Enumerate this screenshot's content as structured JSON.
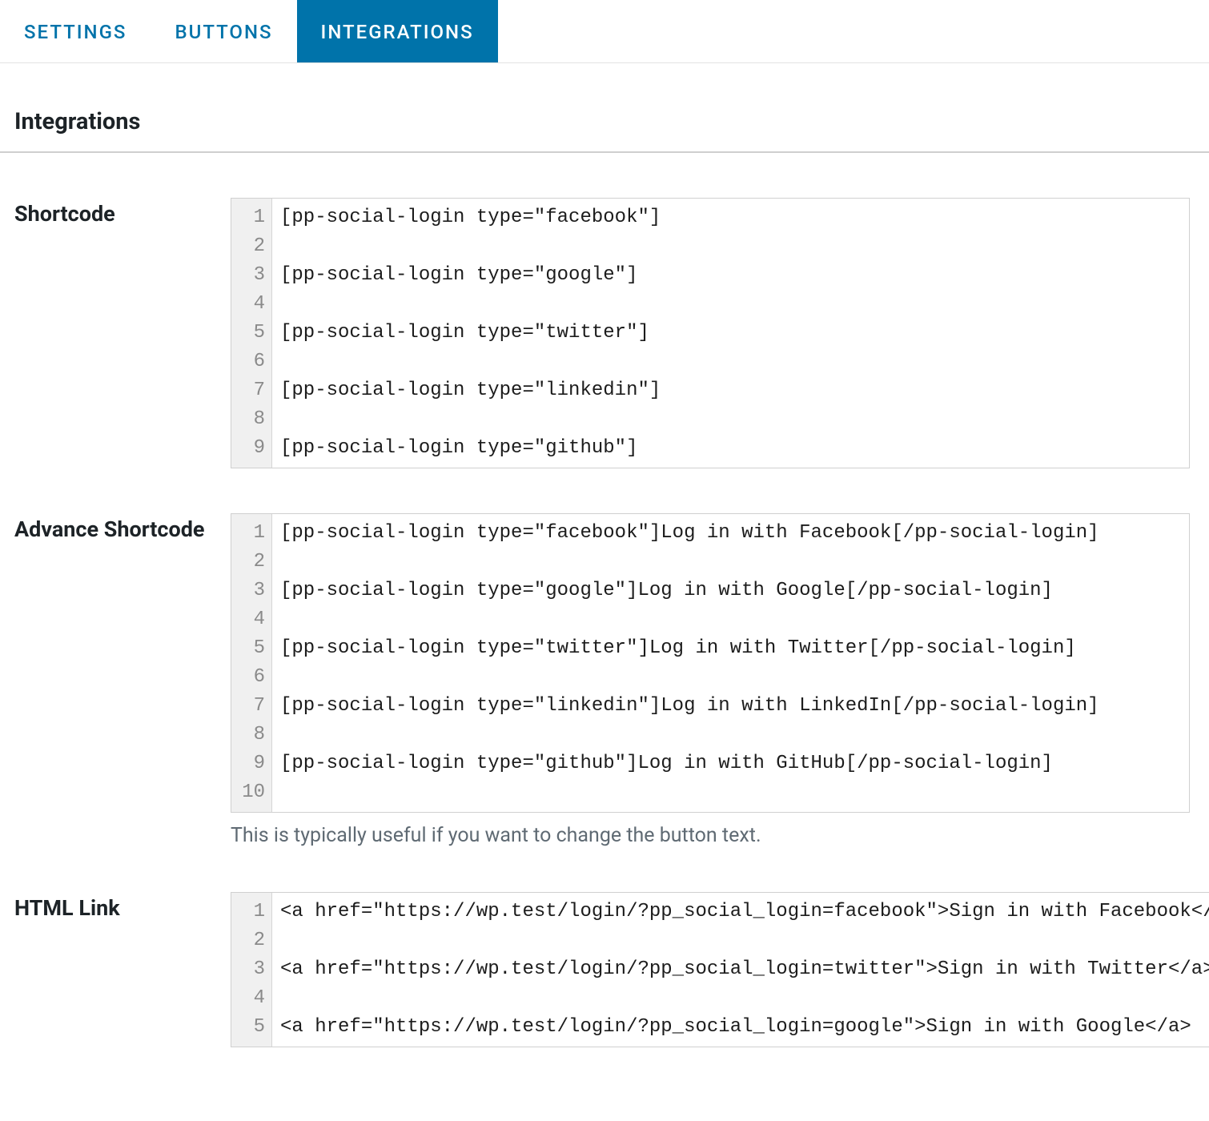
{
  "tabs": [
    {
      "label": "SETTINGS",
      "active": false
    },
    {
      "label": "BUTTONS",
      "active": false
    },
    {
      "label": "INTEGRATIONS",
      "active": true
    }
  ],
  "section_title": "Integrations",
  "fields": {
    "shortcode": {
      "label": "Shortcode",
      "lines": [
        "[pp-social-login type=\"facebook\"]",
        "",
        "[pp-social-login type=\"google\"]",
        "",
        "[pp-social-login type=\"twitter\"]",
        "",
        "[pp-social-login type=\"linkedin\"]",
        "",
        "[pp-social-login type=\"github\"]"
      ]
    },
    "advance_shortcode": {
      "label": "Advance Shortcode",
      "lines": [
        "[pp-social-login type=\"facebook\"]Log in with Facebook[/pp-social-login]",
        "",
        "[pp-social-login type=\"google\"]Log in with Google[/pp-social-login]",
        "",
        "[pp-social-login type=\"twitter\"]Log in with Twitter[/pp-social-login]",
        "",
        "[pp-social-login type=\"linkedin\"]Log in with LinkedIn[/pp-social-login]",
        "",
        "[pp-social-login type=\"github\"]Log in with GitHub[/pp-social-login]",
        ""
      ],
      "helper": "This is typically useful if you want to change the button text."
    },
    "html_link": {
      "label": "HTML Link",
      "lines": [
        "<a href=\"https://wp.test/login/?pp_social_login=facebook\">Sign in with Facebook</a>",
        "",
        "<a href=\"https://wp.test/login/?pp_social_login=twitter\">Sign in with Twitter</a>",
        "",
        "<a href=\"https://wp.test/login/?pp_social_login=google\">Sign in with Google</a>"
      ]
    }
  }
}
